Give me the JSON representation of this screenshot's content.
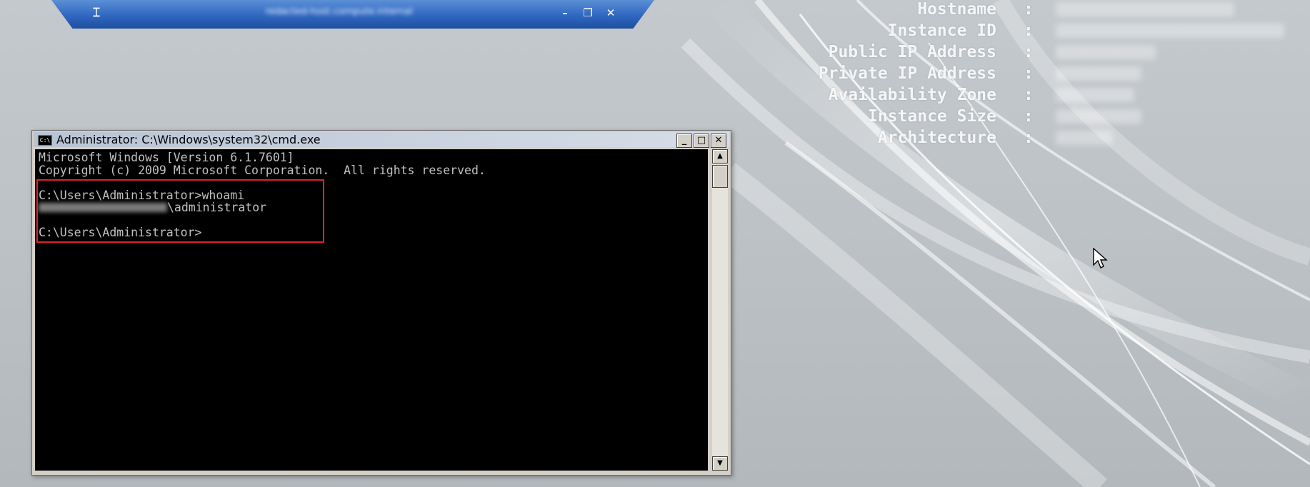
{
  "remote_bar": {
    "pin_icon": "pin-icon",
    "title": "redacted-host.compute.internal",
    "minimize_glyph": "–",
    "restore_glyph": "❐",
    "close_glyph": "✕"
  },
  "instance_info": {
    "colon": ":",
    "rows": [
      {
        "label": "Hostname"
      },
      {
        "label": "Instance ID"
      },
      {
        "label": "Public IP Address"
      },
      {
        "label": "Private IP Address"
      },
      {
        "label": "Availability Zone"
      },
      {
        "label": "Instance Size"
      },
      {
        "label": "Architecture"
      }
    ]
  },
  "cmd": {
    "title": "Administrator: C:\\Windows\\system32\\cmd.exe",
    "icon_text": "C:\\",
    "minimize_glyph": "_",
    "maximize_glyph": "□",
    "close_glyph": "✕",
    "lines": {
      "version": "Microsoft Windows [Version 6.1.7601]",
      "copyright": "Copyright (c) 2009 Microsoft Corporation.  All rights reserved.",
      "prompt_whoami": "C:\\Users\\Administrator>whoami",
      "whoami_suffix": "\\administrator",
      "prompt_end": "C:\\Users\\Administrator>"
    },
    "scroll_up_glyph": "▲",
    "scroll_down_glyph": "▼"
  },
  "colors": {
    "desktop_bg": "#bfc4c8",
    "rdp_bar": "#2f67c0",
    "highlight_box": "#e0202a",
    "console_bg": "#000000",
    "console_text": "#c0c0c0"
  }
}
